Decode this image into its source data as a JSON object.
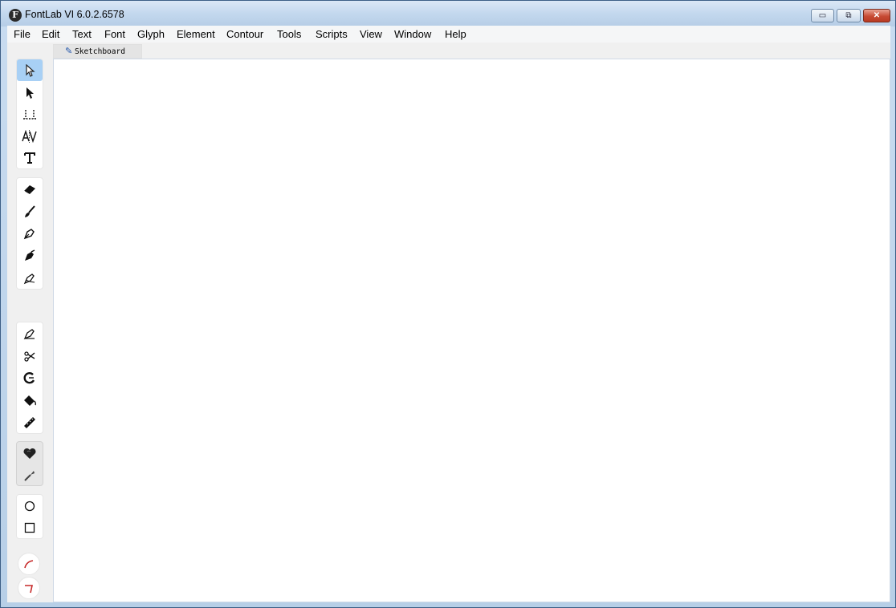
{
  "window": {
    "title": "FontLab VI 6.0.2.6578",
    "app_icon_letter": "F",
    "controls": {
      "minimize": "▭",
      "maximize": "⧉",
      "close": "✕"
    }
  },
  "menubar": {
    "items": [
      "File",
      "Edit",
      "Text",
      "Font",
      "Glyph",
      "Element",
      "Contour",
      "Tools",
      "Scripts",
      "View",
      "Window",
      "Help"
    ]
  },
  "tabs": [
    {
      "label": "Sketchboard",
      "icon": "pen-icon"
    }
  ],
  "toolbar": {
    "groups": [
      {
        "name": "selection",
        "tools": [
          "contour-select-icon",
          "element-select-icon",
          "metrics-icon",
          "kerning-icon",
          "text-icon"
        ]
      },
      {
        "name": "drawing",
        "tools": [
          "eraser-icon",
          "brush-icon",
          "pen-icon",
          "rapid-icon",
          "pencil-icon"
        ]
      },
      {
        "name": "editing",
        "tools": [
          "corner-icon",
          "scissors-icon",
          "magnet-icon",
          "fill-icon",
          "ruler-icon"
        ]
      },
      {
        "name": "transform",
        "tools": [
          "heart-icon",
          "knife-icon"
        ]
      },
      {
        "name": "shapes",
        "tools": [
          "ellipse-icon",
          "rectangle-icon"
        ]
      },
      {
        "name": "sketch",
        "tools": [
          "sketch-curve-icon",
          "sketch-node-icon",
          "sketch-corner-icon"
        ]
      }
    ],
    "active_tool": "contour-select-icon"
  },
  "colors": {
    "accent": "#a8d0f5",
    "close_button": "#c74b34",
    "canvas": "#ffffff"
  }
}
